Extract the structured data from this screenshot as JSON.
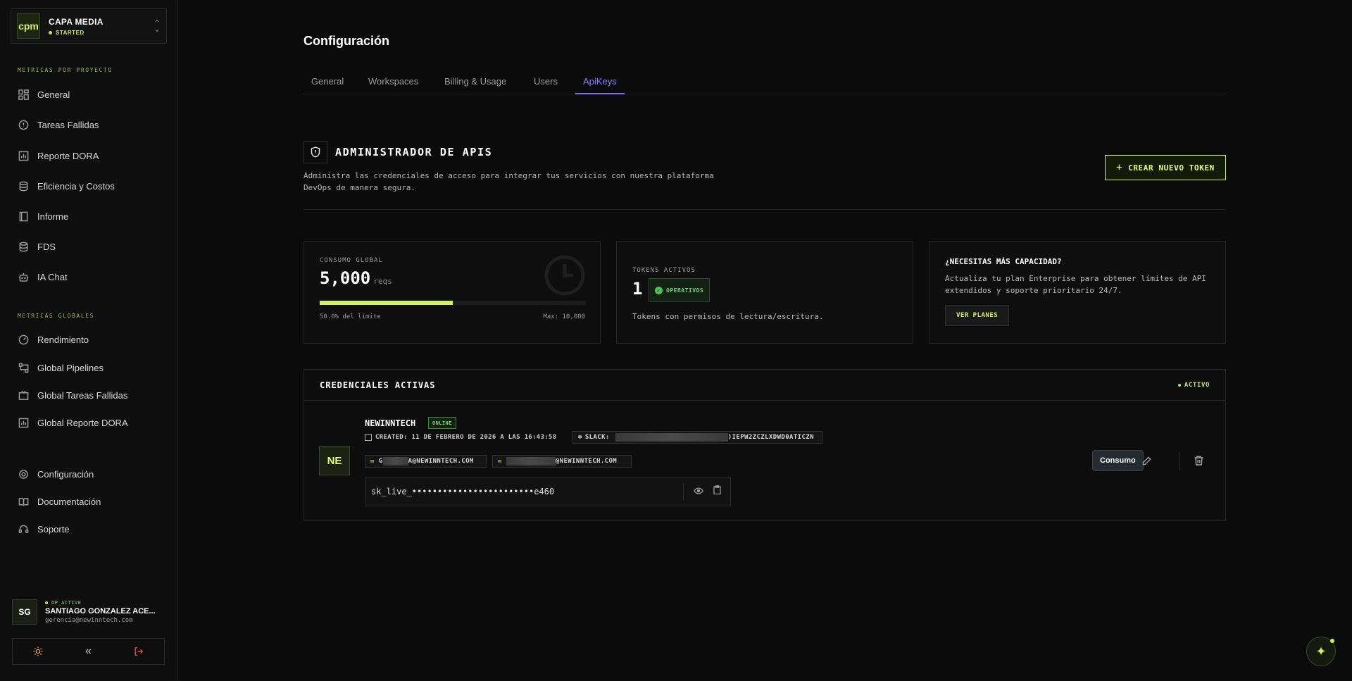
{
  "workspace": {
    "logo": "cpm",
    "name": "CAPA MEDIA",
    "status": "STARTED"
  },
  "sidebar": {
    "section1_title": "METRICAS POR PROYECTO",
    "section1_items": [
      {
        "label": "General",
        "icon": "grid-icon"
      },
      {
        "label": "Tareas Fallidas",
        "icon": "alert-circle-icon"
      },
      {
        "label": "Reporte DORA",
        "icon": "bar-chart-icon"
      },
      {
        "label": "Eficiencia y Costos",
        "icon": "database-icon"
      },
      {
        "label": "Informe",
        "icon": "book-icon"
      },
      {
        "label": "FDS",
        "icon": "database-icon"
      },
      {
        "label": "IA Chat",
        "icon": "bot-icon"
      }
    ],
    "section2_title": "METRICAS GLOBALES",
    "section2_items": [
      {
        "label": "Rendimiento",
        "icon": "gauge-icon"
      },
      {
        "label": "Global Pipelines",
        "icon": "workflow-icon"
      },
      {
        "label": "Global Tareas Fallidas",
        "icon": "tv-icon"
      },
      {
        "label": "Global Reporte DORA",
        "icon": "bar-chart-icon"
      }
    ],
    "footer_items": [
      {
        "label": "Configuración",
        "icon": "gear-icon"
      },
      {
        "label": "Documentación",
        "icon": "book-open-icon"
      },
      {
        "label": "Soporte",
        "icon": "headset-icon"
      }
    ]
  },
  "user": {
    "initials": "SG",
    "status": "OP_ACTIVE",
    "name": "SANTIAGO GONZALEZ ACE...",
    "email": "gerencia@newinntech.com"
  },
  "page": {
    "title": "Configuración",
    "tabs": [
      "General",
      "Workspaces",
      "Billing & Usage",
      "Users",
      "ApiKeys"
    ],
    "active_tab": "ApiKeys"
  },
  "api": {
    "title": "ADMINISTRADOR DE APIS",
    "desc_line1": "Administra las credenciales de acceso para integrar tus servicios con nuestra plataforma",
    "desc_line2": "DevOps de manera segura.",
    "new_token_label": "CREAR NUEVO TOKEN"
  },
  "usage": {
    "label": "CONSUMO GLOBAL",
    "value": "5,000",
    "unit": "reqs",
    "fill_fraction": 0.5,
    "percent_text": "50.0% del límite",
    "max_text": "Max: 10,000"
  },
  "tokens": {
    "label": "TOKENS ACTIVOS",
    "count": "1",
    "badge": "OPERATIVOS",
    "desc": "Tokens con permisos de lectura/escritura."
  },
  "upgrade": {
    "title": "¿NECESITAS MÁS CAPACIDAD?",
    "desc_line1": "Actualiza tu plan Enterprise para obtener límites de API",
    "desc_line2": "extendidos y soporte prioritario 24/7.",
    "button": "VER PLANES"
  },
  "credentials": {
    "title": "CREDENCIALES ACTIVAS",
    "status": "ACTIVO",
    "item": {
      "initials": "NE",
      "name": "NEWINNTECH",
      "badge": "ONLINE",
      "created": "CREATED: 11 DE FEBRERO DE 2026 A LAS 16:43:58",
      "slack_label": "SLACK:",
      "slack_suffix": ")IEPW2ZCZLXDWD0ATICZN",
      "email1_prefix": "G",
      "email1_suffix": "A@NEWINNTECH.COM",
      "email2_suffix": "@NEWINNTECH.COM",
      "key": "sk_live_••••••••••••••••••••••••e460",
      "consumo_button": "Consumo"
    }
  },
  "colors": {
    "accent": "#d4f35a",
    "tab_active": "#8a7cff",
    "danger": "#e05545"
  }
}
